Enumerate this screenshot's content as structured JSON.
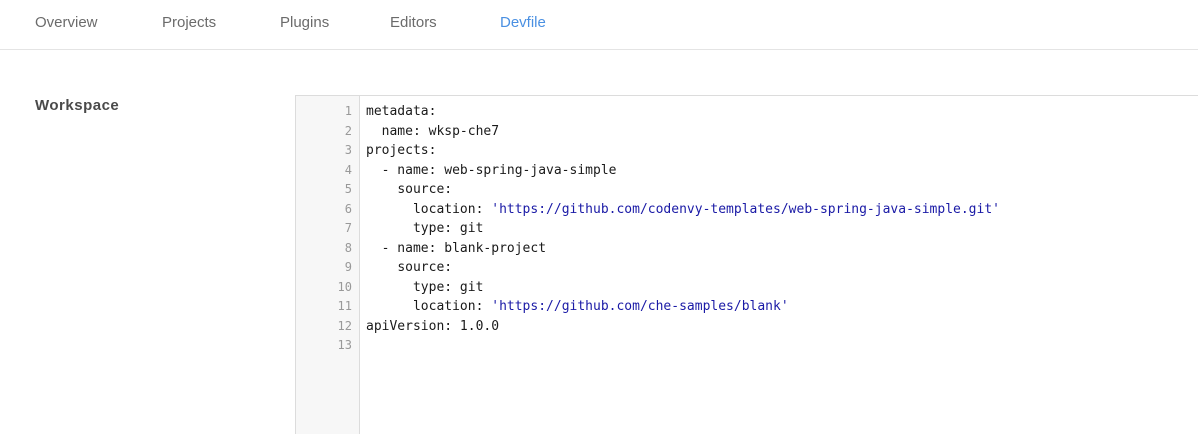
{
  "tabs": [
    {
      "label": "Overview",
      "active": false
    },
    {
      "label": "Projects",
      "active": false
    },
    {
      "label": "Plugins",
      "active": false
    },
    {
      "label": "Editors",
      "active": false
    },
    {
      "label": "Devfile",
      "active": true
    }
  ],
  "section": {
    "label": "Workspace"
  },
  "editor": {
    "line_numbers": [
      "1",
      "2",
      "3",
      "4",
      "5",
      "6",
      "7",
      "8",
      "9",
      "10",
      "11",
      "12",
      "13"
    ],
    "lines": [
      {
        "indent": "",
        "key": "metadata:",
        "value": "",
        "str": ""
      },
      {
        "indent": "  ",
        "key": "name:",
        "value": " wksp-che7",
        "str": ""
      },
      {
        "indent": "",
        "key": "projects:",
        "value": "",
        "str": ""
      },
      {
        "indent": "  ",
        "key": "- name:",
        "value": " web-spring-java-simple",
        "str": ""
      },
      {
        "indent": "    ",
        "key": "source:",
        "value": "",
        "str": ""
      },
      {
        "indent": "      ",
        "key": "location:",
        "value": " ",
        "str": "'https://github.com/codenvy-templates/web-spring-java-simple.git'"
      },
      {
        "indent": "      ",
        "key": "type:",
        "value": " git",
        "str": ""
      },
      {
        "indent": "  ",
        "key": "- name:",
        "value": " blank-project",
        "str": ""
      },
      {
        "indent": "    ",
        "key": "source:",
        "value": "",
        "str": ""
      },
      {
        "indent": "      ",
        "key": "type:",
        "value": " git",
        "str": ""
      },
      {
        "indent": "      ",
        "key": "location:",
        "value": " ",
        "str": "'https://github.com/che-samples/blank'"
      },
      {
        "indent": "",
        "key": "apiVersion:",
        "value": " 1.0.0",
        "str": ""
      },
      {
        "indent": "",
        "key": "",
        "value": "",
        "str": ""
      }
    ]
  }
}
